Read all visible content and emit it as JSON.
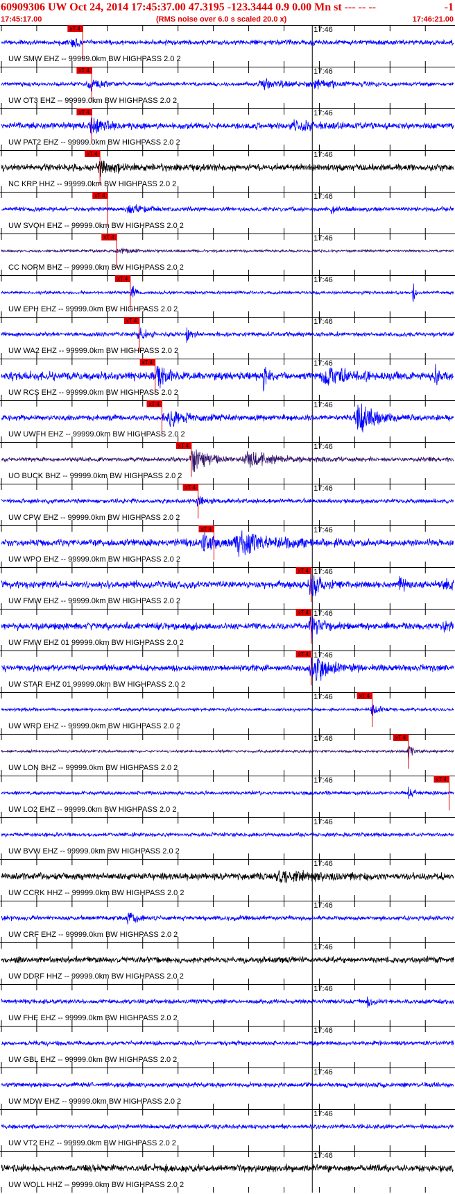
{
  "header": {
    "event_line": "60909306 UW Oct 24, 2014 17:45:37.00   47.3195 -123.3444  0.9 0.00 Mn st --- -- --",
    "event_suffix": "-1",
    "start_time": "17:45:17.00",
    "scaling_note": "(RMS noise over 6.0 s scaled 20.0 x)",
    "end_time": "17:46:21.00"
  },
  "chart_data": {
    "type": "line",
    "time_range": [
      "17:45:17.00",
      "17:46:21.00"
    ],
    "time_marker_label": "17:46",
    "time_marker_fraction": 0.6875,
    "pick_label": "xT 4",
    "colors": {
      "pick": "#e00000",
      "blue": "#0000ff",
      "black": "#000000",
      "purple": "#30106a"
    },
    "traces": [
      {
        "label": "UW SMW EHZ -- 99999.0km BW  HIGHPASS  2.0  2",
        "color": "blue",
        "pick": 0.18,
        "noise": 0.16,
        "bursts": [
          [
            0.155,
            0.4,
            0.01
          ]
        ],
        "seed": 11
      },
      {
        "label": "UW OT3 EHZ -- 99999.0km BW  HIGHPASS  2.0  2",
        "color": "blue",
        "pick": 0.2,
        "noise": 0.12,
        "bursts": [
          [
            0.195,
            0.35,
            0.02
          ],
          [
            0.58,
            0.35,
            0.03
          ],
          [
            0.7,
            0.2,
            0.05
          ]
        ],
        "seed": 23
      },
      {
        "label": "UW PAT2 EHZ -- 99999.0km BW  HIGHPASS  2.0  2",
        "color": "blue",
        "pick": 0.2,
        "noise": 0.2,
        "bursts": [
          [
            0.2,
            0.5,
            0.02
          ],
          [
            0.65,
            0.25,
            0.04
          ]
        ],
        "seed": 37
      },
      {
        "label": "NC KRP HHZ -- 99999.0km BW  HIGHPASS  2.0  2",
        "color": "black",
        "pick": 0.218,
        "noise": 0.22,
        "bursts": [
          [
            0.22,
            0.35,
            0.02
          ]
        ],
        "seed": 41
      },
      {
        "label": "UW SVOH EHZ -- 99999.0km BW  HIGHPASS  2.0  2",
        "color": "blue",
        "pick": 0.235,
        "noise": 0.14,
        "bursts": [
          [
            0.28,
            0.35,
            0.02
          ],
          [
            0.73,
            0.3,
            0.01
          ]
        ],
        "seed": 53
      },
      {
        "label": "CC NORM BHZ -- 99999.0km BW  HIGHPASS  2.0  2",
        "color": "purple",
        "pick": 0.255,
        "noise": 0.08,
        "bursts": [
          [
            0.26,
            0.2,
            0.02
          ]
        ],
        "seed": 67
      },
      {
        "label": "UW EPH EHZ -- 99999.0km BW  HIGHPASS  2.0  2",
        "color": "blue",
        "pick": 0.285,
        "noise": 0.1,
        "bursts": [
          [
            0.288,
            1.0,
            0.004
          ],
          [
            0.91,
            1.0,
            0.003
          ]
        ],
        "seed": 71
      },
      {
        "label": "UW WA2 EHZ -- 99999.0km BW  HIGHPASS  2.0  2",
        "color": "blue",
        "pick": 0.305,
        "noise": 0.14,
        "bursts": [
          [
            0.305,
            0.6,
            0.01
          ],
          [
            0.41,
            0.7,
            0.005
          ]
        ],
        "seed": 83
      },
      {
        "label": "UW RCS EHZ -- 99999.0km BW  HIGHPASS  2.0  2",
        "color": "blue",
        "pick": 0.34,
        "noise": 0.25,
        "bursts": [
          [
            0.345,
            1.0,
            0.012
          ],
          [
            0.58,
            0.8,
            0.006
          ],
          [
            0.72,
            0.6,
            0.03
          ],
          [
            0.96,
            1.0,
            0.006
          ]
        ],
        "seed": 97
      },
      {
        "label": "UW UWFH EHZ -- 99999.0km BW  HIGHPASS  2.0  2",
        "color": "blue",
        "pick": 0.355,
        "noise": 0.18,
        "bursts": [
          [
            0.37,
            0.5,
            0.03
          ],
          [
            0.79,
            1.0,
            0.025
          ]
        ],
        "seed": 101
      },
      {
        "label": "UO BUCK BHZ -- 99999.0km BW  HIGHPASS  2.0  2",
        "color": "purple",
        "pick": 0.42,
        "noise": 0.14,
        "bursts": [
          [
            0.425,
            0.9,
            0.02
          ],
          [
            0.55,
            0.5,
            0.04
          ]
        ],
        "seed": 113
      },
      {
        "label": "UW CPW EHZ -- 99999.0km BW  HIGHPASS  2.0  2",
        "color": "blue",
        "pick": 0.435,
        "noise": 0.14,
        "bursts": [
          [
            0.435,
            0.4,
            0.01
          ]
        ],
        "seed": 127
      },
      {
        "label": "UW WPO EHZ -- 99999.0km BW  HIGHPASS  2.0  2",
        "color": "blue",
        "pick": 0.47,
        "noise": 0.22,
        "bursts": [
          [
            0.53,
            0.7,
            0.05
          ],
          [
            0.45,
            0.6,
            0.02
          ]
        ],
        "seed": 131
      },
      {
        "label": "UW FMW EHZ -- 99999.0km BW  HIGHPASS  2.0  2",
        "color": "blue",
        "pick": 0.685,
        "noise": 0.22,
        "bursts": [
          [
            0.685,
            1.0,
            0.012
          ],
          [
            0.88,
            0.4,
            0.01
          ],
          [
            0.98,
            0.3,
            0.01
          ]
        ],
        "seed": 139
      },
      {
        "label": "UW FMW EHZ 01 99999.0km BW  HIGHPASS  2.0  2",
        "color": "blue",
        "pick": 0.685,
        "noise": 0.22,
        "bursts": [
          [
            0.685,
            1.0,
            0.012
          ],
          [
            0.98,
            0.3,
            0.01
          ]
        ],
        "seed": 149
      },
      {
        "label": "UW STAR EHZ 01 99999.0km BW  HIGHPASS  2.0  2",
        "color": "blue",
        "pick": 0.685,
        "noise": 0.2,
        "bursts": [
          [
            0.69,
            0.9,
            0.025
          ]
        ],
        "seed": 151
      },
      {
        "label": "UW WRD EHZ -- 99999.0km BW  HIGHPASS  2.0  2",
        "color": "blue",
        "pick": 0.82,
        "noise": 0.1,
        "bursts": [
          [
            0.82,
            0.35,
            0.01
          ]
        ],
        "seed": 157
      },
      {
        "label": "UW LON BHZ -- 99999.0km BW  HIGHPASS  2.0  2",
        "color": "purple",
        "pick": 0.9,
        "noise": 0.08,
        "bursts": [
          [
            0.9,
            0.5,
            0.006
          ]
        ],
        "seed": 163
      },
      {
        "label": "UW LO2 EHZ -- 99999.0km BW  HIGHPASS  2.0  2",
        "color": "blue",
        "pick": 0.99,
        "noise": 0.12,
        "bursts": [
          [
            0.9,
            0.4,
            0.006
          ]
        ],
        "seed": 167
      },
      {
        "label": "UW BVW EHZ -- 99999.0km BW  HIGHPASS  2.0  2",
        "color": "blue",
        "pick": null,
        "noise": 0.13,
        "bursts": [],
        "seed": 173
      },
      {
        "label": "UW CCRK HHZ -- 99999.0km BW  HIGHPASS  2.0  2",
        "color": "black",
        "pick": null,
        "noise": 0.22,
        "bursts": [
          [
            0.62,
            0.3,
            0.05
          ]
        ],
        "seed": 179
      },
      {
        "label": "UW CRF EHZ -- 99999.0km BW  HIGHPASS  2.0  2",
        "color": "blue",
        "pick": null,
        "noise": 0.14,
        "bursts": [
          [
            0.28,
            0.4,
            0.01
          ]
        ],
        "seed": 181
      },
      {
        "label": "UW DDRF HHZ -- 99999.0km BW  HIGHPASS  2.0  2",
        "color": "black",
        "pick": null,
        "noise": 0.2,
        "bursts": [],
        "seed": 191
      },
      {
        "label": "UW FHE EHZ -- 99999.0km BW  HIGHPASS  2.0  2",
        "color": "blue",
        "pick": null,
        "noise": 0.14,
        "bursts": [
          [
            0.81,
            0.7,
            0.004
          ]
        ],
        "seed": 193
      },
      {
        "label": "UW GBL EHZ -- 99999.0km BW  HIGHPASS  2.0  2",
        "color": "blue",
        "pick": null,
        "noise": 0.14,
        "bursts": [],
        "seed": 197
      },
      {
        "label": "UW MDW EHZ -- 99999.0km BW  HIGHPASS  2.0  2",
        "color": "blue",
        "pick": null,
        "noise": 0.15,
        "bursts": [],
        "seed": 199
      },
      {
        "label": "UW VT2 EHZ -- 99999.0km BW  HIGHPASS  2.0  2",
        "color": "blue",
        "pick": null,
        "noise": 0.14,
        "bursts": [],
        "seed": 211
      },
      {
        "label": "UW WOLL HHZ -- 99999.0km BW  HIGHPASS  2.0  2",
        "color": "black",
        "pick": null,
        "noise": 0.22,
        "bursts": [],
        "seed": 223
      }
    ]
  }
}
